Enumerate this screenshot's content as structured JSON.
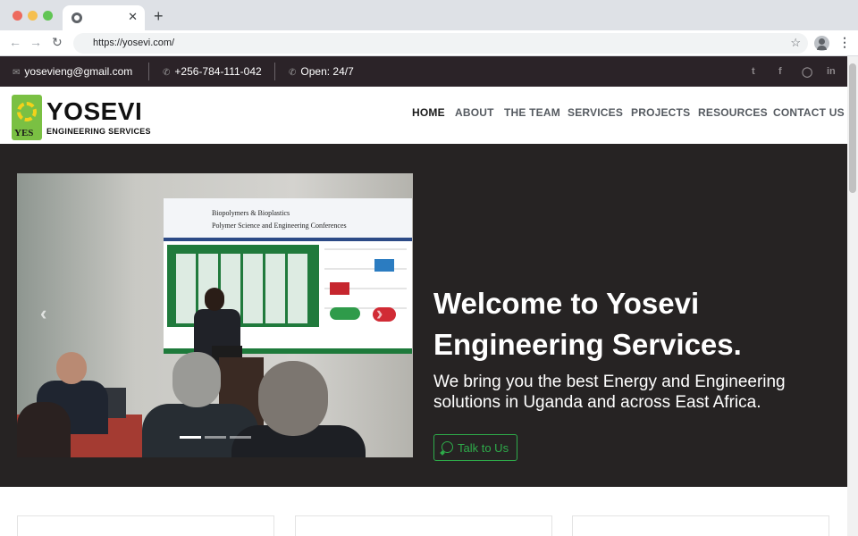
{
  "browser": {
    "url": "https://yosevi.com/",
    "tab_close": "✕",
    "new_tab": "+"
  },
  "topbar": {
    "email": "yosevieng@gmail.com",
    "phone": "+256-784-111-042",
    "hours": "Open: 24/7",
    "social": [
      "twitter-icon",
      "facebook-icon",
      "instagram-icon",
      "linkedin-icon"
    ]
  },
  "header": {
    "logo_mark_text": "YES",
    "logo_name": "YOSEVI",
    "logo_sub": "ENGINEERING SERVICES",
    "nav": {
      "home": "HOME",
      "about": "ABOUT",
      "team": "THE TEAM",
      "services": "SERVICES",
      "projects": "PROJECTS",
      "resources": "RESOURCES",
      "contact": "CONTACT US"
    },
    "active_nav": "HOME"
  },
  "hero": {
    "title_line1": "Welcome to Yosevi",
    "title_line2": "Engineering Services.",
    "subtitle": "We bring you the best Energy and Engineering solutions in Uganda and across East Africa.",
    "cta": "Talk to Us",
    "carousel": {
      "slide_count": 3,
      "active_slide": 1,
      "banner_line1": "Biopolymers & Bioplastics",
      "banner_line2": "Polymer Science and Engineering Conferences"
    }
  },
  "colors": {
    "topbar_bg": "#2b2328",
    "hero_bg": "#262323",
    "accent_green": "#2eab4a",
    "logo_green": "#7ac043"
  }
}
